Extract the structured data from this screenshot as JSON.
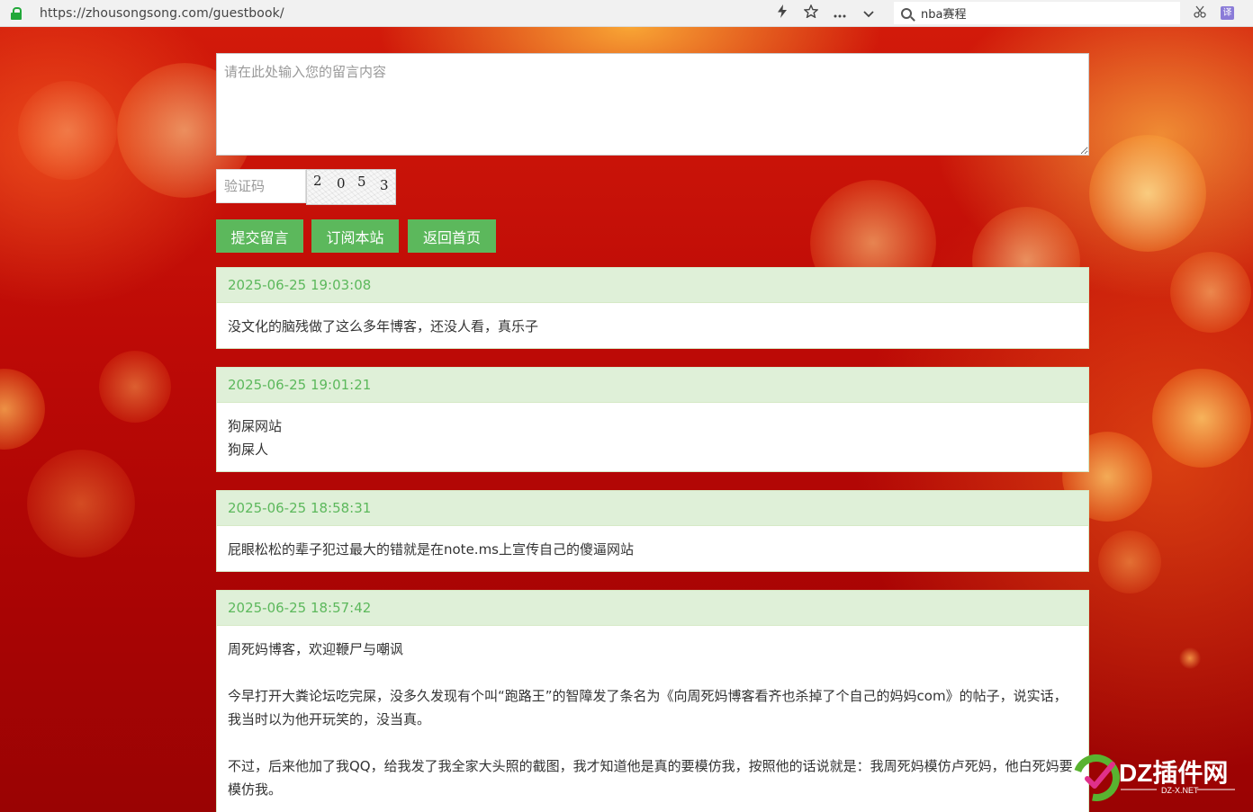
{
  "browser": {
    "url": "https://zhousongsong.com/guestbook/",
    "search_query": "nba赛程",
    "toolbar_icons": [
      "bolt-icon",
      "star-icon",
      "more-icon",
      "chevron-down-icon"
    ],
    "right_icons": [
      "scissors-icon",
      "translate-extension-icon"
    ],
    "translate_icon_label": "译"
  },
  "form": {
    "message_placeholder": "请在此处输入您的留言内容",
    "captcha_placeholder": "验证码",
    "captcha_chars": [
      "2",
      "0",
      "5",
      "3"
    ],
    "buttons": {
      "submit": "提交留言",
      "subscribe": "订阅本站",
      "home": "返回首页"
    },
    "button_color": "#5cb85c"
  },
  "comments": [
    {
      "time": "2025-06-25 19:03:08",
      "lines": [
        "没文化的脑残做了这么多年博客，还没人看，真乐子"
      ]
    },
    {
      "time": "2025-06-25 19:01:21",
      "lines": [
        "狗屎网站",
        "狗屎人"
      ]
    },
    {
      "time": "2025-06-25 18:58:31",
      "lines": [
        "屁眼松松的辈子犯过最大的错就是在note.ms上宣传自己的傻逼网站"
      ]
    },
    {
      "time": "2025-06-25 18:57:42",
      "lines": [
        "周死妈博客，欢迎鞭尸与嘲讽",
        "",
        "今早打开大粪论坛吃完屎，没多久发现有个叫“跑路王”的智障发了条名为《向周死妈博客看齐也杀掉了个自己的妈妈com》的帖子，说实话，我当时以为他开玩笑的，没当真。",
        "",
        "不过，后来他加了我QQ，给我发了我全家大头照的截图，我才知道他是真的要模仿我，按照他的话说就是：我周死妈模仿卢死妈，他白死妈要模仿我。"
      ]
    }
  ],
  "watermark": {
    "brand": "DZ插件网",
    "sub": "DZ-X.NET"
  }
}
